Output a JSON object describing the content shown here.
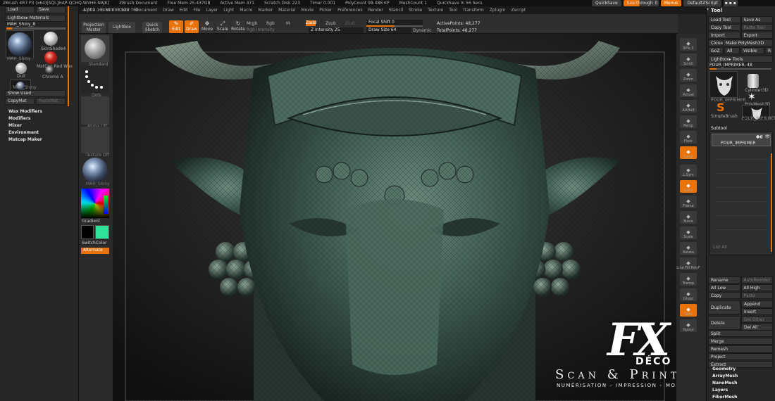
{
  "titlebar": {
    "items": [
      "ZBrush 4R7 P3 (x64)[SQI-JHAP-QCHQ-WVHE-NAJK]",
      "ZBrush Document",
      "Free Mem 25.437GB",
      "Active Mem 471",
      "Scratch Disk 223",
      "Timer 0.001",
      "PolyCount 98.486 KP",
      "MeshCount 1",
      "QuickSave In 56 Secs"
    ],
    "quicksave": "QuickSave",
    "seethrough": "See-through",
    "seethrough_value": "0",
    "menus_label": "Menus",
    "default_script": "DefaultZScript"
  },
  "menubar": {
    "items": [
      "Alpha",
      "Brush",
      "Color",
      "Document",
      "Draw",
      "Edit",
      "File",
      "Layer",
      "Light",
      "Macro",
      "Marker",
      "Material",
      "Movie",
      "Picker",
      "Preferences",
      "Render",
      "Stencil",
      "Stroke",
      "Texture",
      "Tool",
      "Transform",
      "Zplugin",
      "Zscript"
    ]
  },
  "left_panel": {
    "load": "Load",
    "save": "Save",
    "lightbox_materials": "Lightbox▸ Materials",
    "current_material": "MAH_Shiny_8",
    "materials": [
      "MAH_Shiny",
      "SkinShade4",
      "MatCap Red Wax",
      "Dull",
      "Chrome A",
      "MAH_Shiny"
    ],
    "show_used": "Show Used",
    "copymat": "CopyMat",
    "pastemat": "PasteMat",
    "sections": [
      "Wax Modifiers",
      "Modifiers",
      "Mixer",
      "Environment",
      "Matcap Maker"
    ]
  },
  "top_shelf": {
    "projection_master": "Projection Master",
    "lightbox": "LightBox",
    "quick_sketch": "Quick Sketch",
    "edit": "Edit",
    "draw": "Draw",
    "move": "Move",
    "scale": "Scale",
    "rotate": "Rotate",
    "mrgb": "Mrgb",
    "rgb": "Rgb",
    "m": "M",
    "zadd": "Zadd",
    "zsub": "Zsub",
    "zcut": "Zcut",
    "rgb_intensity": "Rgb Intensity",
    "z_intensity": "Z Intensity 25",
    "focal_shift": "Focal Shift 0",
    "draw_size": "Draw Size 64",
    "dynamic": "Dynamic",
    "active_points": "ActivePoints: 48,277",
    "total_points": "TotalPoints: 48,277",
    "coords": "-1.303,16,-38.898,520,768"
  },
  "left_shelf": {
    "brush": "Standard",
    "stroke": "Dots",
    "alpha": "Alpha Off",
    "texture": "Texture Off",
    "material": "MAH_Shiny",
    "gradient": "Gradient",
    "switch_color": "SwitchColor",
    "alternate": "Alternate"
  },
  "right_shelf": {
    "items": [
      "SPix 3",
      "Scroll",
      "Zoom",
      "Actual",
      "AAHalf",
      "Persp",
      "Floor",
      "Local",
      "L.Sym",
      "Gxyz",
      "Frame",
      "Move",
      "Scale",
      "Rotate",
      "Line Fill PolyF",
      "Transp",
      "Ghost",
      "Solo",
      "Xpose"
    ]
  },
  "tool_panel": {
    "title": "Tool",
    "load_tool": "Load Tool",
    "save_as": "Save As",
    "copy_tool": "Copy Tool",
    "paste_tool": "Paste Tool",
    "import": "Import",
    "export": "Export",
    "clone": "Clone",
    "make_polymesh": "Make PolyMesh3D",
    "goz": "GoZ",
    "all": "All",
    "visible": "Visible",
    "r": "R",
    "lightbox_tools": "Lightbox▸ Tools",
    "current_tool": "POUR_IMPRIMER. 48",
    "tools": [
      "POUR_IMPRIMER",
      "Cylinder3D",
      "PolyMesh3D",
      "SimpleBrush",
      "POUR_IMPRIMER"
    ],
    "subtool": "Subtool",
    "subtool_name": "POUR_IMPRIMER",
    "list_all": "List All",
    "rename": "Rename",
    "autoreorder": "AutoReorder",
    "all_low": "All Low",
    "all_high": "All High",
    "copy": "Copy",
    "paste": "Paste",
    "duplicate": "Duplicate",
    "append": "Append",
    "insert": "Insert",
    "delete": "Delete",
    "del_other": "Del Other",
    "del_all": "Del All",
    "sections": [
      "Split",
      "Merge",
      "Remesh",
      "Project",
      "Extract"
    ],
    "geometry": "Geometry",
    "arraymesh": "ArrayMesh",
    "nanomesh": "NanoMesh",
    "layers": "Layers",
    "fibermesh": "FiberMesh"
  },
  "watermark": {
    "logo_letters": "FX",
    "deco": "DÉCO",
    "scan_print": "Scan & Print",
    "three_d": "3D",
    "tagline": "NUMÉRISATION – IMPRESSION – MODÉLISATION"
  },
  "colors": {
    "accent": "#e8720c",
    "primary_color": "#000000",
    "secondary_color": "#2fe49a",
    "bull_base": "#3e5a52"
  }
}
